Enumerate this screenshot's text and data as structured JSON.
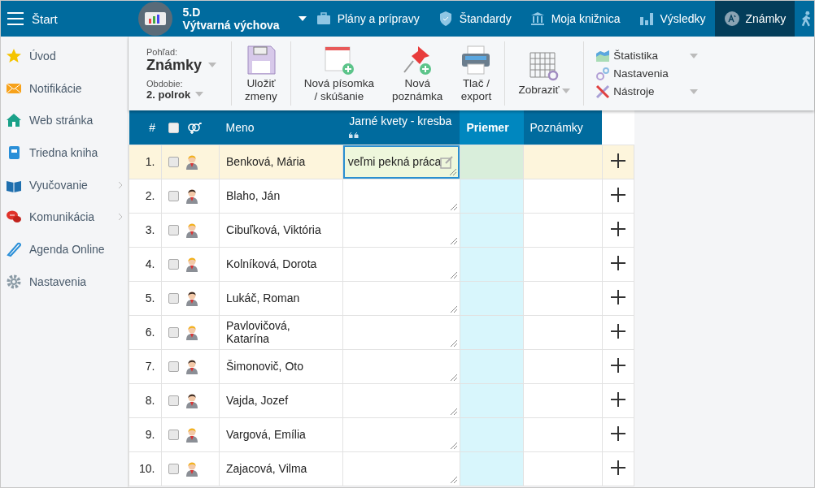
{
  "topbar": {
    "menu_label": "Štart",
    "class_name": "5.D",
    "subject": "Výtvarná výchova",
    "nav": [
      {
        "label": "Plány a prípravy",
        "kind": "briefcase",
        "selected": false
      },
      {
        "label": "Štandardy",
        "kind": "shield",
        "selected": false
      },
      {
        "label": "Moja knižnica",
        "kind": "library",
        "selected": false
      },
      {
        "label": "Výsledky",
        "kind": "bars",
        "selected": false
      },
      {
        "label": "Známky",
        "kind": "grade",
        "selected": true
      }
    ]
  },
  "sidebar": {
    "items": [
      {
        "label": "Úvod",
        "kind": "star",
        "has_submenu": false
      },
      {
        "label": "Notifikácie",
        "kind": "mail",
        "has_submenu": false
      },
      {
        "label": "Web stránka",
        "kind": "house",
        "has_submenu": false
      },
      {
        "label": "Triedna kniha",
        "kind": "notebook",
        "has_submenu": false
      },
      {
        "label": "Vyučovanie",
        "kind": "book",
        "has_submenu": true
      },
      {
        "label": "Komunikácia",
        "kind": "chat",
        "has_submenu": true
      },
      {
        "label": "Agenda Online",
        "kind": "pen",
        "has_submenu": false
      },
      {
        "label": "Nastavenia",
        "kind": "gear",
        "has_submenu": false
      }
    ]
  },
  "toolbar": {
    "view_label": "Pohľad:",
    "view_value": "Známky",
    "period_label": "Obdobie:",
    "period_value": "2. polrok",
    "buttons": [
      {
        "label": "Uložiť\nzmeny",
        "kind": "floppy"
      },
      {
        "label": "Nová písomka\n/ skúšanie",
        "kind": "calendar"
      },
      {
        "label": "Nová\npoznámka",
        "kind": "pin"
      },
      {
        "label": "Tlač /\nexport",
        "kind": "printer"
      }
    ],
    "display_label": "Zobraziť",
    "menu": [
      {
        "label": "Štatistika",
        "kind": "chart",
        "has_dropdown": true
      },
      {
        "label": "Nastavenia",
        "kind": "gears",
        "has_dropdown": false
      },
      {
        "label": "Nástroje",
        "kind": "tools",
        "has_dropdown": true
      }
    ]
  },
  "table": {
    "select_all_checked": false,
    "columns": {
      "number": "#",
      "name": "Meno",
      "assessment": "Jarné kvety - kresba",
      "average": "Priemer",
      "notes": "Poznámky"
    },
    "rows": [
      {
        "number": "1.",
        "name": "Benková, Mária",
        "kind": "female",
        "checked": false,
        "selected": true,
        "assessment": "veľmi pekná práca"
      },
      {
        "number": "2.",
        "name": "Blaho, Ján",
        "kind": "male",
        "checked": false,
        "selected": false
      },
      {
        "number": "3.",
        "name": "Cibuľková, Viktória",
        "kind": "female",
        "checked": false,
        "selected": false
      },
      {
        "number": "4.",
        "name": "Kolníková, Dorota",
        "kind": "female",
        "checked": false,
        "selected": false
      },
      {
        "number": "5.",
        "name": "Lukáč, Roman",
        "kind": "male",
        "checked": false,
        "selected": false
      },
      {
        "number": "6.",
        "name": "Pavlovičová, Katarína",
        "kind": "female",
        "checked": false,
        "selected": false
      },
      {
        "number": "7.",
        "name": "Šimonovič, Oto",
        "kind": "male",
        "checked": false,
        "selected": false
      },
      {
        "number": "8.",
        "name": "Vajda, Jozef",
        "kind": "male",
        "checked": false,
        "selected": false
      },
      {
        "number": "9.",
        "name": "Vargová, Emília",
        "kind": "female",
        "checked": false,
        "selected": false
      },
      {
        "number": "10.",
        "name": "Zajacová, Vilma",
        "kind": "female",
        "checked": false,
        "selected": false
      }
    ]
  }
}
